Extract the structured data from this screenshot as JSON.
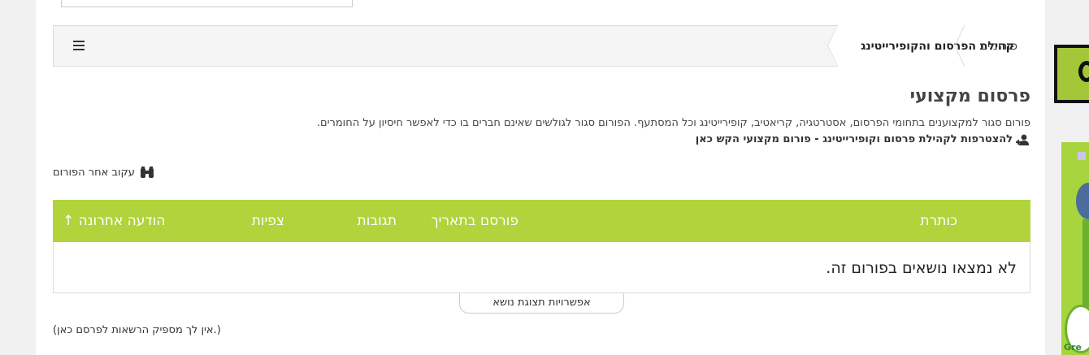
{
  "breadcrumb": {
    "root": "פורומים",
    "current": "קהילת הפרסום והקופירייטינג"
  },
  "forum": {
    "title": "פרסום מקצועי",
    "description": "פורום סגור למקצוענים בתחומי הפרסום, אסטרטגיה, קריאטיב, קופירייטינג וכל המסתעף. הפורום סגור לגולשים שאינם חברים בו כדי לאפשר חיסיון על החומרים.",
    "join_link": "להצטרפות לקהילת פרסום וקופירייטינג - פורום מקצועי הקש כאן",
    "follow_link": "עקוב אחר הפורום"
  },
  "table": {
    "headers": {
      "title": "כותרת",
      "posted_on": "פורסם בתאריך",
      "replies": "תגובות",
      "views": "צפיות",
      "last_post": "הודעה אחרונה ↑"
    },
    "empty_message": "לא נמצאו נושאים בפורום זה."
  },
  "options_tab": "אפשרויות תצוגת נושא",
  "permission_text": "(אין לך מספיק הרשאות לפרסם כאן.)",
  "ad": {
    "text": "Gre"
  },
  "colors": {
    "accent": "#b1d33b",
    "header_text": "#ffffff"
  },
  "icons": {
    "menu": "hamburger-icon",
    "join": "user-plus-icon",
    "follow": "binoculars-icon"
  }
}
